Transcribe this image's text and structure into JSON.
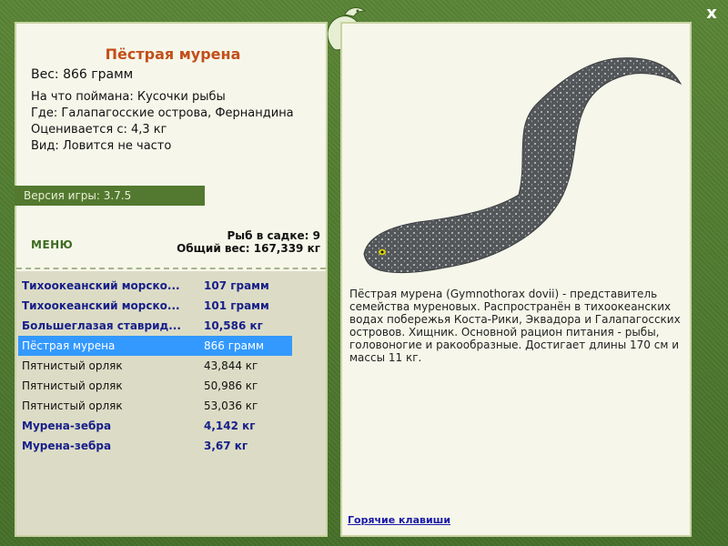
{
  "close_label": "x",
  "fish": {
    "title": "Пёстрая мурена",
    "weight": "Вес: 866 грамм",
    "caught_on": "На что поймана: Кусочки рыбы",
    "location": "Где: Галапагосские острова, Фернандина",
    "valued_from": "Оценивается с: 4,3 кг",
    "frequency": "Вид: Ловится не часто"
  },
  "version": "Версия игры: 3.7.5",
  "menu_label": "МЕНЮ",
  "stats": {
    "fish_in_keepnet": "Рыб в садке: 9",
    "total_weight": "Общий вес: 167,339 кг"
  },
  "catch_list": [
    {
      "name": "Тихоокеанский морско...",
      "weight": "107 грамм",
      "style": "bold"
    },
    {
      "name": "Тихоокеанский морско...",
      "weight": "101 грамм",
      "style": "bold"
    },
    {
      "name": "Большеглазая ставрид...",
      "weight": "10,586 кг",
      "style": "bold"
    },
    {
      "name": "Пёстрая мурена",
      "weight": "866 грамм",
      "style": "selected"
    },
    {
      "name": "Пятнистый орляк",
      "weight": "43,844 кг",
      "style": "normal"
    },
    {
      "name": "Пятнистый орляк",
      "weight": "50,986 кг",
      "style": "normal"
    },
    {
      "name": "Пятнистый орляк",
      "weight": "53,036 кг",
      "style": "normal"
    },
    {
      "name": "Мурена-зебра",
      "weight": "4,142 кг",
      "style": "bold"
    },
    {
      "name": "Мурена-зебра",
      "weight": "3,67 кг",
      "style": "bold"
    }
  ],
  "description": "Пёстрая мурена (Gymnothorax dovii) - представитель семейства муреновых. Распространён в тихоокеанских водах побережья Коста-Рики, Эквадора и Галапагосских островов. Хищник. Основной рацион питания - рыбы, головоногие и ракообразные. Достигает длины 170 см и массы 11 кг.",
  "hotkeys_label": "Горячие клавиши",
  "colors": {
    "frame": "#4f7a2e",
    "panel": "#f6f7ea",
    "title": "#c24f1a",
    "list_bold": "#18208a",
    "selected": "#3399ff"
  },
  "icons": [
    "logo-lizard-icon",
    "close-icon",
    "moray-eel-illustration"
  ]
}
